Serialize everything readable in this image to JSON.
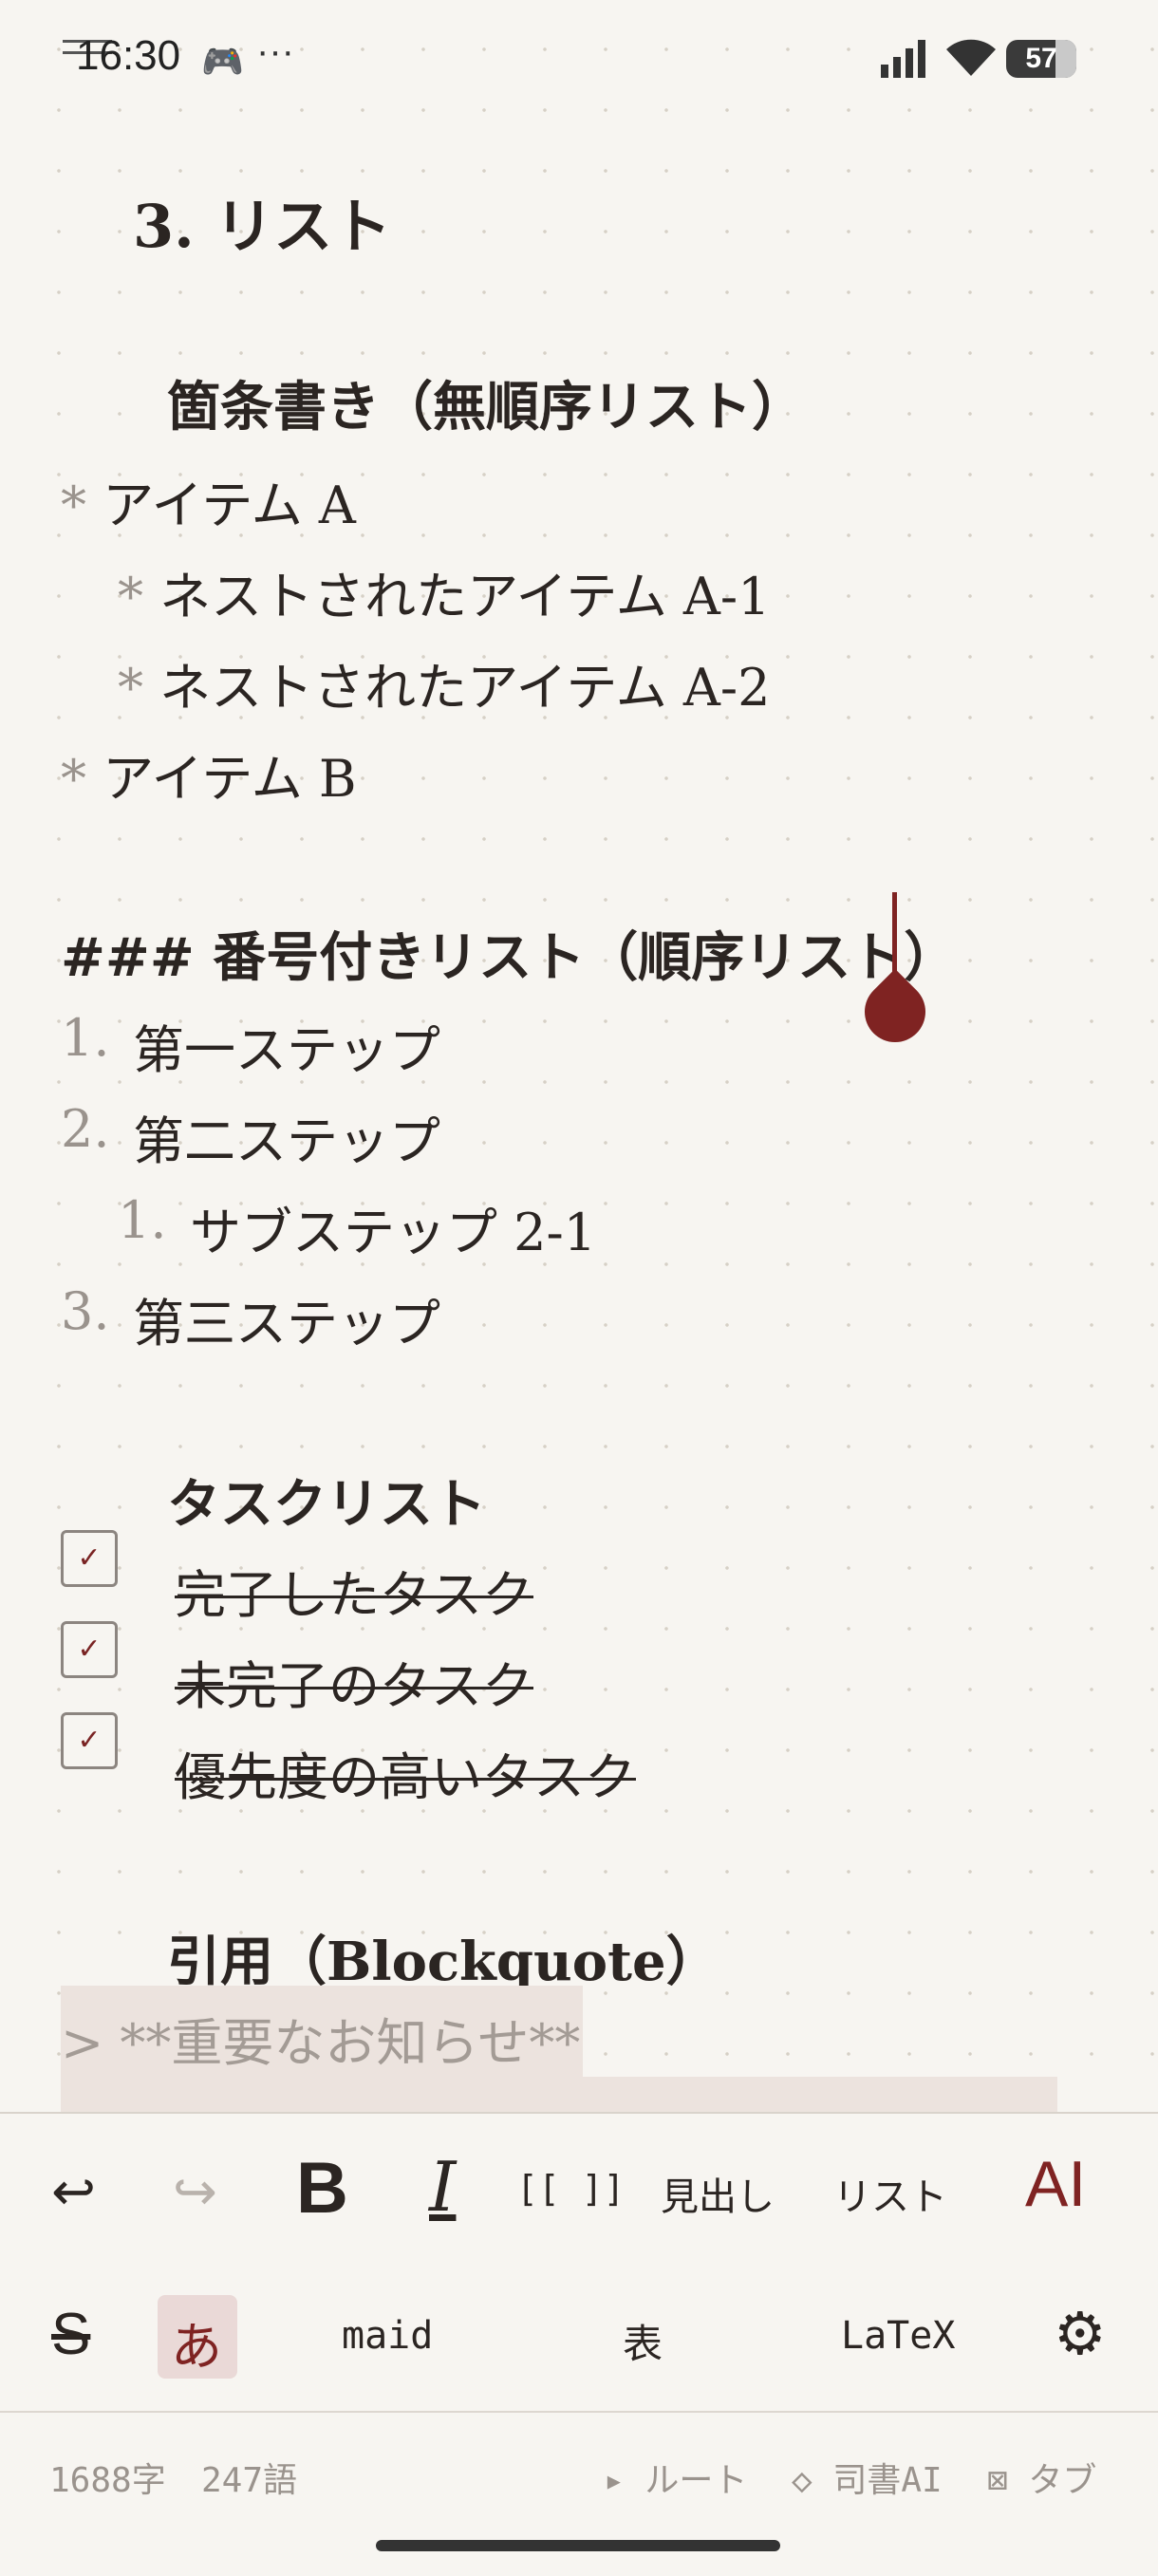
{
  "status_bar": {
    "time": "16:30",
    "dots": "···",
    "battery": "57"
  },
  "document": {
    "heading_list": "3. リスト",
    "heading_unordered": "箇条書き（無順序リスト）",
    "unordered_items": [
      {
        "bullet": "*",
        "text": "アイテム A"
      },
      {
        "bullet": "*",
        "text": "ネストされたアイテム A-1"
      },
      {
        "bullet": "*",
        "text": "ネストされたアイテム A-2"
      },
      {
        "bullet": "*",
        "text": "アイテム B"
      }
    ],
    "heading_ordered": "### 番号付きリスト（順序リスト）",
    "ordered_items": [
      {
        "num": "1.",
        "text": "第一ステップ"
      },
      {
        "num": "2.",
        "text": "第二ステップ"
      },
      {
        "num": "1.",
        "text": "サブステップ 2-1"
      },
      {
        "num": "3.",
        "text": "第三ステップ"
      }
    ],
    "heading_tasks": "タスクリスト",
    "tasks": [
      {
        "text": "完了したタスク",
        "check": "✓"
      },
      {
        "text": "未完了のタスク",
        "check": "✓"
      },
      {
        "text": "優先度の高いタスク",
        "check": "✓"
      }
    ],
    "heading_quote": "引用（Blockquote）",
    "quote_line": "> **重要なお知らせ**"
  },
  "toolbar": {
    "undo": "↩",
    "redo": "↪",
    "bold": "B",
    "italic": "I",
    "link": "[[ ]]",
    "heading": "見出し",
    "list": "リスト",
    "ai": "AI",
    "strike": "S",
    "kana": "あ",
    "maid": "maid",
    "table": "表",
    "latex": "LaTeX",
    "settings": "⚙"
  },
  "footer": {
    "char_count": "1688字",
    "word_count": "247語",
    "route": "▸ ルート",
    "librarian": "◇ 司書AI",
    "tab": "⊠ タブ"
  },
  "colors": {
    "accent": "#7f2322",
    "background": "#f7f5f1",
    "muted": "#9a938d"
  }
}
